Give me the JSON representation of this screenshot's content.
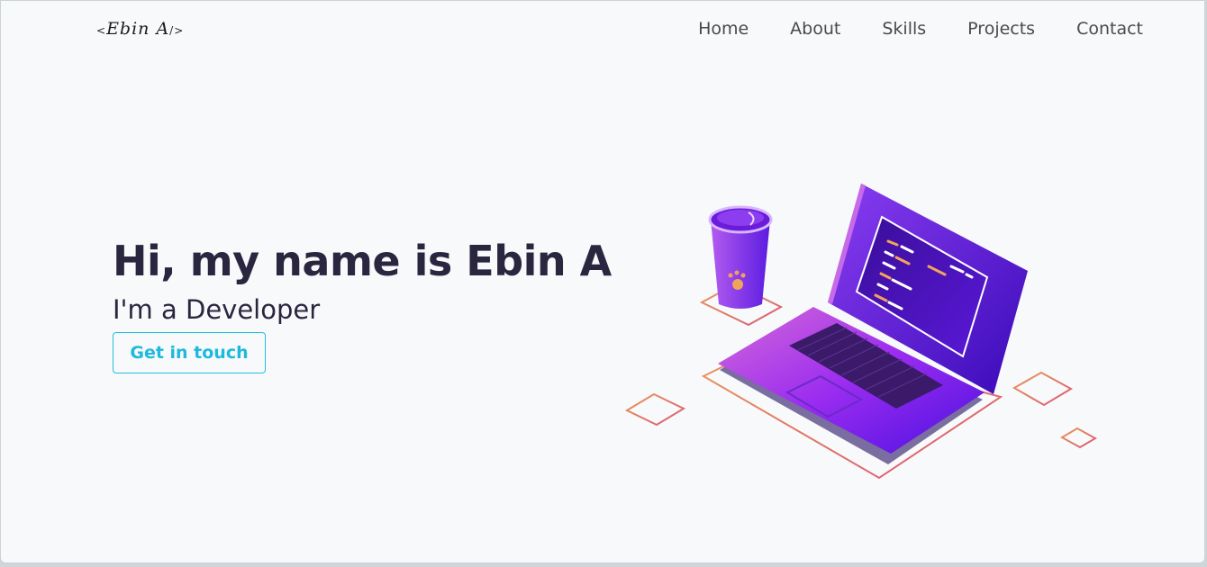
{
  "brand": {
    "logo_open": "<",
    "logo_name": "Ebin A",
    "logo_close": "/>"
  },
  "nav": {
    "items": [
      {
        "label": "Home"
      },
      {
        "label": "About"
      },
      {
        "label": "Skills"
      },
      {
        "label": "Projects"
      },
      {
        "label": "Contact"
      }
    ]
  },
  "hero": {
    "heading": "Hi, my name is Ebin A",
    "subheading": "I'm a Developer",
    "cta_label": "Get in touch"
  },
  "colors": {
    "background": "#f8f9fa",
    "heading": "#2b2640",
    "accent": "#1eb9de",
    "nav_text": "#4a4a4a",
    "laptop_purple": "#6a1fe0",
    "outline_gradient_start": "#e89a5a",
    "outline_gradient_end": "#d9587a"
  },
  "illustration": {
    "icon": "laptop-with-coffee-cup-illustration"
  }
}
